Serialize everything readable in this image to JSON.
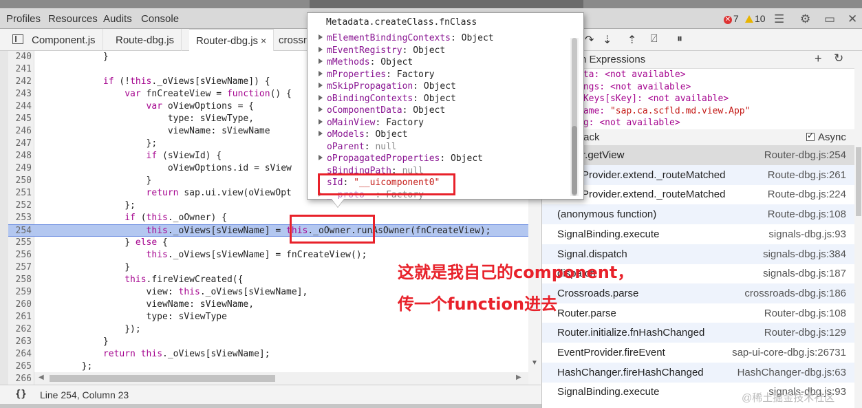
{
  "top_tabs": [
    "Profiles",
    "Resources",
    "Audits",
    "Console"
  ],
  "errors_count": "7",
  "warnings_count": "10",
  "file_tabs": [
    {
      "label": "Component.js"
    },
    {
      "label": "Route-dbg.js"
    },
    {
      "label": "Router-dbg.js",
      "close": "×"
    },
    {
      "label": "crossr"
    }
  ],
  "code_lines": [
    {
      "num": "240",
      "code": "            }"
    },
    {
      "num": "241",
      "code": ""
    },
    {
      "num": "242",
      "code": "            if (!this._oViews[sViewName]) {"
    },
    {
      "num": "243",
      "code": "                var fnCreateView = function() {"
    },
    {
      "num": "244",
      "code": "                    var oViewOptions = {"
    },
    {
      "num": "245",
      "code": "                        type: sViewType,"
    },
    {
      "num": "246",
      "code": "                        viewName: sViewName"
    },
    {
      "num": "247",
      "code": "                    };"
    },
    {
      "num": "248",
      "code": "                    if (sViewId) {"
    },
    {
      "num": "249",
      "code": "                        oViewOptions.id = sView"
    },
    {
      "num": "250",
      "code": "                    }"
    },
    {
      "num": "251",
      "code": "                    return sap.ui.view(oViewOpt"
    },
    {
      "num": "252",
      "code": "                };"
    },
    {
      "num": "253",
      "code": "                if (this._oOwner) {"
    },
    {
      "num": "254",
      "code": "                    this._oViews[sViewName] = this._oOwner.runAsOwner(fnCreateView);"
    },
    {
      "num": "255",
      "code": "                } else {"
    },
    {
      "num": "256",
      "code": "                    this._oViews[sViewName] = fnCreateView();"
    },
    {
      "num": "257",
      "code": "                }"
    },
    {
      "num": "258",
      "code": "                this.fireViewCreated({"
    },
    {
      "num": "259",
      "code": "                    view: this._oViews[sViewName],"
    },
    {
      "num": "260",
      "code": "                    viewName: sViewName,"
    },
    {
      "num": "261",
      "code": "                    type: sViewType"
    },
    {
      "num": "262",
      "code": "                });"
    },
    {
      "num": "263",
      "code": "            }"
    },
    {
      "num": "264",
      "code": "            return this._oViews[sViewName];"
    },
    {
      "num": "265",
      "code": "        };"
    },
    {
      "num": "266",
      "code": ""
    }
  ],
  "highlighted_line": "254",
  "status": {
    "braces": "{}",
    "position": "Line 254, Column 23"
  },
  "popover": {
    "title": "Metadata.createClass.fnClass",
    "props": [
      {
        "key": "mElementBindingContexts",
        "value": "Object",
        "expandable": true
      },
      {
        "key": "mEventRegistry",
        "value": "Object",
        "expandable": true
      },
      {
        "key": "mMethods",
        "value": "Object",
        "expandable": true
      },
      {
        "key": "mProperties",
        "value": "Factory",
        "expandable": true
      },
      {
        "key": "mSkipPropagation",
        "value": "Object",
        "expandable": true
      },
      {
        "key": "oBindingContexts",
        "value": "Object",
        "expandable": true
      },
      {
        "key": "oComponentData",
        "value": "Object",
        "expandable": true
      },
      {
        "key": "oMainView",
        "value": "Factory",
        "expandable": true
      },
      {
        "key": "oModels",
        "value": "Object",
        "expandable": true
      },
      {
        "key": "oParent",
        "value": "null",
        "expandable": false
      },
      {
        "key": "oPropagatedProperties",
        "value": "Object",
        "expandable": true
      },
      {
        "key": "sBindingPath",
        "value": "null",
        "expandable": false
      },
      {
        "key": "sId",
        "value": "\"__uicomponent0\"",
        "expandable": false
      },
      {
        "key": "__proto__",
        "value": "Factory",
        "expandable": true
      }
    ]
  },
  "watch": {
    "header": "n Expressions",
    "items": [
      {
        "name": "eta:",
        "value": "<not available>"
      },
      {
        "name": "ings:",
        "value": "<not available>"
      },
      {
        "name": "dKeys[sKey]:",
        "value": "<not available>"
      },
      {
        "name": "Name:",
        "value": "\"sap.ca.scfld.md.view.App\""
      },
      {
        "name": "ig:",
        "value": "<not available>"
      }
    ]
  },
  "callstack": {
    "header": "tack",
    "async_label": "Async",
    "frames": [
      {
        "fn": "r.getView",
        "loc": "Router-dbg.js:254"
      },
      {
        "fn": "Provider.extend._routeMatched",
        "loc": "Route-dbg.js:261"
      },
      {
        "fn": "Provider.extend._routeMatched",
        "loc": "Route-dbg.js:224"
      },
      {
        "fn": "(anonymous function)",
        "loc": "Route-dbg.js:108"
      },
      {
        "fn": "SignalBinding.execute",
        "loc": "signals-dbg.js:93"
      },
      {
        "fn": "Signal.dispatch",
        "loc": "signals-dbg.js:384"
      },
      {
        "fn": "dispatch",
        "loc": "signals-dbg.js:187"
      },
      {
        "fn": "Crossroads.parse",
        "loc": "crossroads-dbg.js:186"
      },
      {
        "fn": "Router.parse",
        "loc": "Router-dbg.js:108"
      },
      {
        "fn": "Router.initialize.fnHashChanged",
        "loc": "Router-dbg.js:129"
      },
      {
        "fn": "EventProvider.fireEvent",
        "loc": "sap-ui-core-dbg.js:26731"
      },
      {
        "fn": "HashChanger.fireHashChanged",
        "loc": "HashChanger-dbg.js:63"
      },
      {
        "fn": "SignalBinding.execute",
        "loc": "signals-dbg.js:93"
      }
    ]
  },
  "annotation": {
    "line1": "这就是我自己的component，",
    "line2": "传一个function进去"
  },
  "watermark": "@稀土掘金技术社区",
  "icons": [
    "pause-icon",
    "step-over-icon",
    "step-into-icon",
    "step-out-icon",
    "deactivate-breakpoints-icon",
    "pause-on-exceptions-icon",
    "settings-icon",
    "dock-icon",
    "close-icon",
    "console-drawer-icon"
  ],
  "colors": {
    "annotation_red": "#e8212a",
    "line_highlight": "#b3c7f0",
    "keyword": "#a5058f"
  }
}
